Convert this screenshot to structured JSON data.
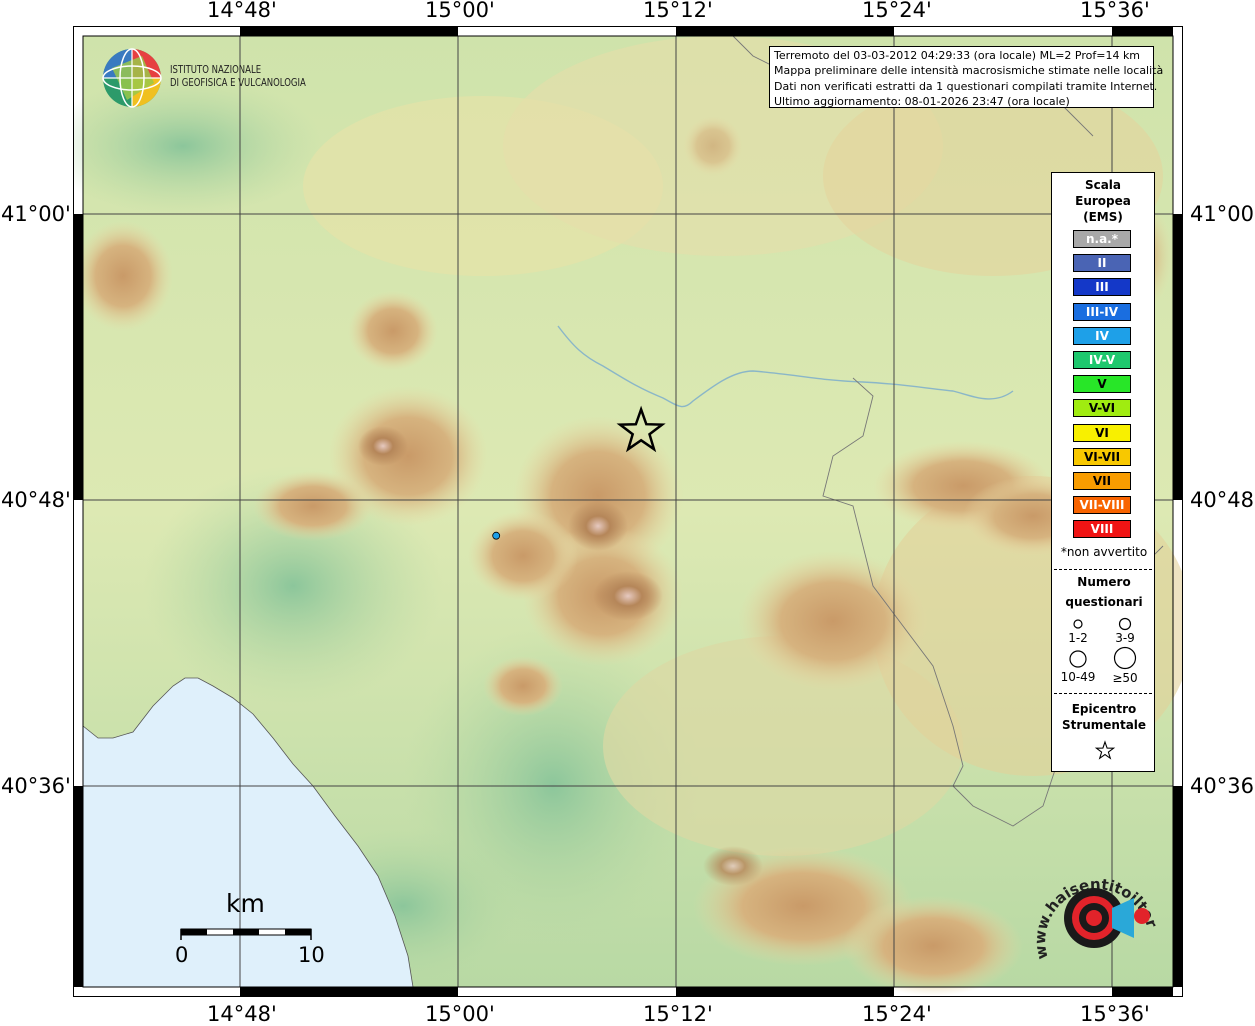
{
  "header": {
    "info_lines": [
      "Terremoto del 03-03-2012 04:29:33 (ora locale) ML=2 Prof=14 km",
      "Mappa preliminare delle intensità macrosismiche stimate nelle località",
      "Dati non verificati estratti da 1 questionari compilati tramite Internet.",
      "Ultimo aggiornamento: 08-01-2026 23:47 (ora locale)"
    ]
  },
  "logo": {
    "line1": "ISTITUTO NAZIONALE",
    "line2": "DI GEOFISICA E VULCANOLOGIA"
  },
  "axes": {
    "lon_labels": [
      "14°48'",
      "15°00'",
      "15°12'",
      "15°24'",
      "15°36'"
    ],
    "lat_labels": [
      "41°00'",
      "40°48'",
      "40°36'"
    ]
  },
  "legend": {
    "title_lines": [
      "Scala",
      "Europea",
      "(EMS)"
    ],
    "classes": [
      {
        "label": "n.a.*",
        "color": "#a8a8a8"
      },
      {
        "label": "II",
        "color": "#4a64b4"
      },
      {
        "label": "III",
        "color": "#1438c8"
      },
      {
        "label": "III-IV",
        "color": "#1a6ee0"
      },
      {
        "label": "IV",
        "color": "#1ea0e8"
      },
      {
        "label": "IV-V",
        "color": "#1ec86e"
      },
      {
        "label": "V",
        "color": "#28e628"
      },
      {
        "label": "V-VI",
        "color": "#a0ec10"
      },
      {
        "label": "VI",
        "color": "#f8f000"
      },
      {
        "label": "VI-VII",
        "color": "#f8c800"
      },
      {
        "label": "VII",
        "color": "#f89c00"
      },
      {
        "label": "VII-VIII",
        "color": "#f86400"
      },
      {
        "label": "VIII",
        "color": "#f01414"
      }
    ],
    "not_felt_note": "*non avvertito",
    "questionnaires_title_1": "Numero",
    "questionnaires_title_2": "questionari",
    "sizes": [
      "1-2",
      "3-9",
      "10-49",
      "≥50"
    ],
    "epicenter_title_1": "Epicentro",
    "epicenter_title_2": "Strumentale"
  },
  "scale_bar": {
    "unit": "km",
    "min": "0",
    "max": "10"
  },
  "watermark": "www.haisentitoilterremoto.it",
  "markers": {
    "epicenter": {
      "lon": 15.168,
      "lat": 40.848
    },
    "observations": [
      {
        "lon": 15.035,
        "lat": 40.775,
        "intensity": "IV",
        "count": 1
      }
    ]
  }
}
